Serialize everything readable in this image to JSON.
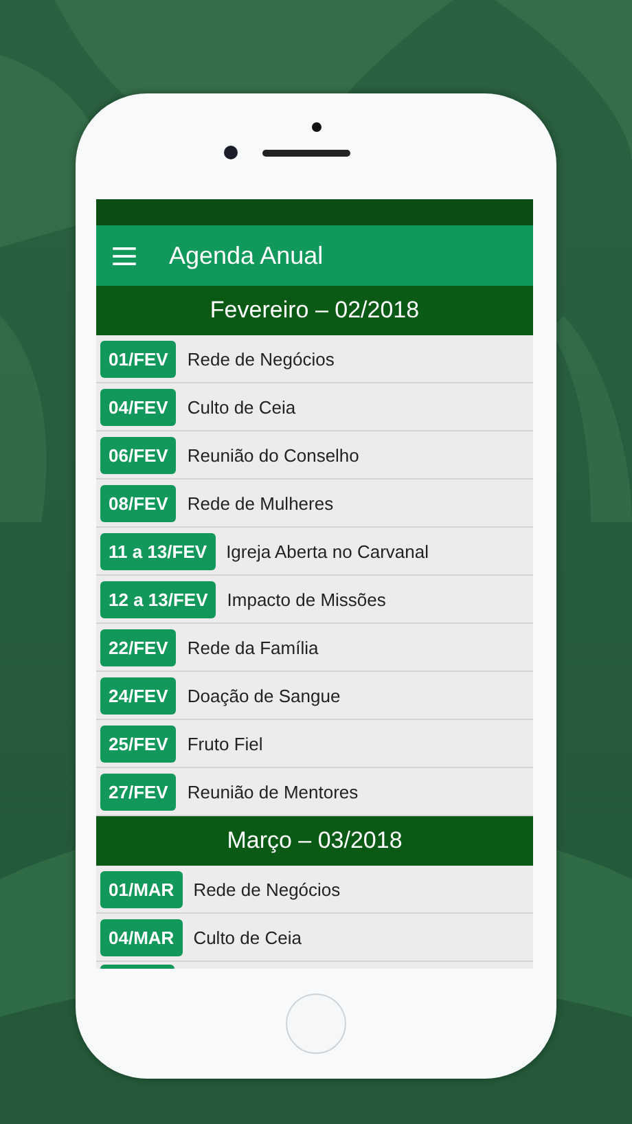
{
  "app_bar": {
    "title": "Agenda Anual"
  },
  "sections": [
    {
      "title": "Fevereiro – 02/2018",
      "events": [
        {
          "date": "01/FEV",
          "name": "Rede de Negócios"
        },
        {
          "date": "04/FEV",
          "name": "Culto de Ceia"
        },
        {
          "date": "06/FEV",
          "name": "Reunião do Conselho"
        },
        {
          "date": "08/FEV",
          "name": "Rede de Mulheres"
        },
        {
          "date": "11 a 13/FEV",
          "name": "Igreja Aberta no Carvanal"
        },
        {
          "date": "12 a 13/FEV",
          "name": "Impacto de Missões"
        },
        {
          "date": "22/FEV",
          "name": "Rede da Família"
        },
        {
          "date": "24/FEV",
          "name": "Doação de Sangue"
        },
        {
          "date": "25/FEV",
          "name": "Fruto Fiel"
        },
        {
          "date": "27/FEV",
          "name": "Reunião de Mentores"
        }
      ]
    },
    {
      "title": "Março – 03/2018",
      "events": [
        {
          "date": "01/MAR",
          "name": "Rede de Negócios"
        },
        {
          "date": "04/MAR",
          "name": "Culto de Ceia"
        }
      ]
    }
  ]
}
